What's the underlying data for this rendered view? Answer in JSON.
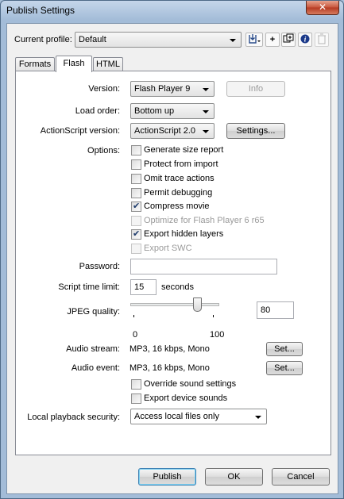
{
  "window": {
    "title": "Publish Settings",
    "close_glyph": "✕"
  },
  "profile": {
    "label": "Current profile:",
    "value": "Default",
    "icons": [
      "import-export-icon",
      "add-profile-icon",
      "duplicate-profile-icon",
      "info-icon",
      "delete-icon"
    ]
  },
  "tabs": [
    {
      "label": "Formats",
      "active": false
    },
    {
      "label": "Flash",
      "active": true
    },
    {
      "label": "HTML",
      "active": false
    }
  ],
  "flash": {
    "version": {
      "label": "Version:",
      "value": "Flash Player 9",
      "info_button": "Info"
    },
    "load_order": {
      "label": "Load order:",
      "value": "Bottom up"
    },
    "actionscript": {
      "label": "ActionScript version:",
      "value": "ActionScript 2.0",
      "settings_button": "Settings..."
    },
    "options": {
      "label": "Options:",
      "items": [
        {
          "label": "Generate size report",
          "checked": false,
          "enabled": true
        },
        {
          "label": "Protect from import",
          "checked": false,
          "enabled": true
        },
        {
          "label": "Omit trace actions",
          "checked": false,
          "enabled": true
        },
        {
          "label": "Permit debugging",
          "checked": false,
          "enabled": true
        },
        {
          "label": "Compress movie",
          "checked": true,
          "enabled": true
        },
        {
          "label": "Optimize for Flash Player 6 r65",
          "checked": false,
          "enabled": false
        },
        {
          "label": "Export hidden layers",
          "checked": true,
          "enabled": true
        },
        {
          "label": "Export SWC",
          "checked": false,
          "enabled": false
        }
      ]
    },
    "password": {
      "label": "Password:",
      "value": ""
    },
    "script_time_limit": {
      "label": "Script time limit:",
      "value": "15",
      "unit": "seconds"
    },
    "jpeg_quality": {
      "label": "JPEG quality:",
      "value": "80",
      "level": 80,
      "min_label": "0",
      "max_label": "100"
    },
    "audio_stream": {
      "label": "Audio stream:",
      "value": "MP3, 16 kbps, Mono",
      "set_button": "Set..."
    },
    "audio_event": {
      "label": "Audio event:",
      "value": "MP3, 16 kbps, Mono",
      "set_button": "Set..."
    },
    "override_sound": {
      "label": "Override sound settings",
      "checked": false
    },
    "export_device_sounds": {
      "label": "Export device sounds",
      "checked": false
    },
    "local_playback": {
      "label": "Local playback security:",
      "value": "Access local files only"
    }
  },
  "footer": {
    "publish": "Publish",
    "ok": "OK",
    "cancel": "Cancel"
  }
}
